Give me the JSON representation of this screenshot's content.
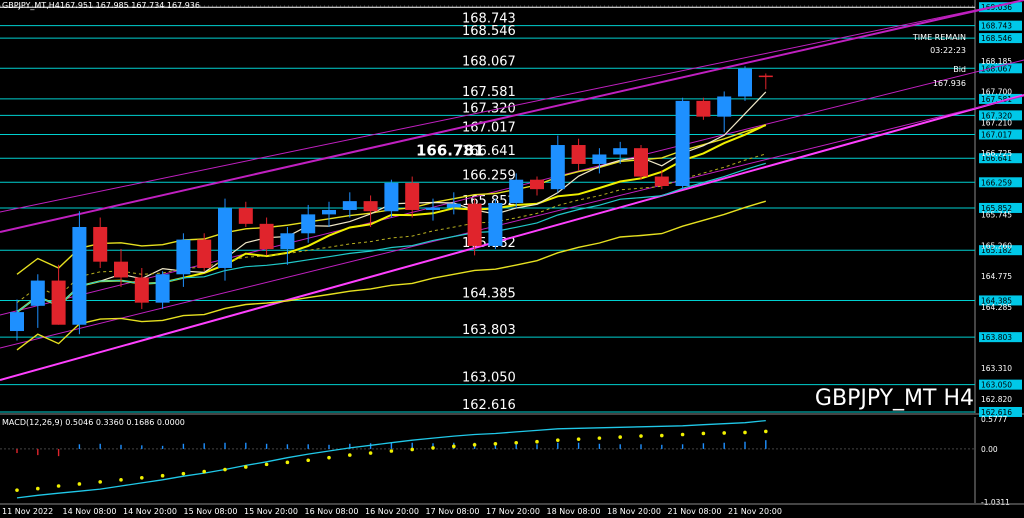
{
  "chart_data": {
    "type": "candlestick",
    "symbol": "GBPJPY_MT,H4",
    "header_quote": "167.951 167.985 167.734 167.936",
    "watermark": "GBPJPY_MT H4",
    "time_remain_label": "TIME REMAIN",
    "time_remain_value": "03:22:23",
    "bid_label": "Bid",
    "bid_value": "167.936",
    "pivot_label": "166.781",
    "ylim": [
      162.6,
      169.15
    ],
    "price_axis_ticks": [
      "168.185",
      "167.700",
      "167.210",
      "166.725",
      "165.745",
      "165.260",
      "164.775",
      "164.285",
      "163.310",
      "162.820"
    ],
    "levels": [
      {
        "label": "169.036",
        "value": 169.036,
        "line_color": "#ffffff",
        "show_left": false
      },
      {
        "label": "168.743",
        "value": 168.743,
        "line_color": "#00d0d0",
        "show_left": true
      },
      {
        "label": "168.546",
        "value": 168.546,
        "line_color": "#00d0d0",
        "show_left": true
      },
      {
        "label": "168.067",
        "value": 168.067,
        "line_color": "#00d0d0",
        "show_left": true
      },
      {
        "label": "167.581",
        "value": 167.581,
        "line_color": "#00d0d0",
        "show_left": true
      },
      {
        "label": "167.320",
        "value": 167.32,
        "line_color": "#00d0d0",
        "show_left": true
      },
      {
        "label": "167.017",
        "value": 167.017,
        "line_color": "#00d0d0",
        "show_left": true
      },
      {
        "label": "166.641",
        "value": 166.641,
        "line_color": "#00d0d0",
        "show_left": true
      },
      {
        "label": "166.259",
        "value": 166.259,
        "line_color": "#00d0d0",
        "show_left": true
      },
      {
        "label": "165.852",
        "value": 165.852,
        "line_color": "#00d0d0",
        "show_left": true
      },
      {
        "label": "165.182",
        "value": 165.182,
        "line_color": "#00d0d0",
        "show_left": true
      },
      {
        "label": "164.385",
        "value": 164.385,
        "line_color": "#00d0d0",
        "show_left": true
      },
      {
        "label": "163.803",
        "value": 163.803,
        "line_color": "#00d0d0",
        "show_left": true
      },
      {
        "label": "163.050",
        "value": 163.05,
        "line_color": "#00d0d0",
        "show_left": true
      },
      {
        "label": "162.616",
        "value": 162.616,
        "line_color": "#00d0d0",
        "show_left": true
      }
    ],
    "x_labels": [
      "11 Nov 2022",
      "14 Nov 08:00",
      "14 Nov 20:00",
      "15 Nov 08:00",
      "15 Nov 20:00",
      "16 Nov 08:00",
      "16 Nov 20:00",
      "17 Nov 08:00",
      "17 Nov 20:00",
      "18 Nov 08:00",
      "18 Nov 20:00",
      "21 Nov 08:00",
      "21 Nov 20:00"
    ],
    "candles": [
      {
        "o": 163.9,
        "h": 164.4,
        "l": 163.75,
        "c": 164.2
      },
      {
        "o": 164.3,
        "h": 164.8,
        "l": 163.95,
        "c": 164.7
      },
      {
        "o": 164.7,
        "h": 164.95,
        "l": 164.0,
        "c": 164.0
      },
      {
        "o": 164.0,
        "h": 165.8,
        "l": 163.85,
        "c": 165.55
      },
      {
        "o": 165.55,
        "h": 165.7,
        "l": 164.9,
        "c": 165.0
      },
      {
        "o": 165.0,
        "h": 165.2,
        "l": 164.6,
        "c": 164.75
      },
      {
        "o": 164.75,
        "h": 164.9,
        "l": 164.25,
        "c": 164.35
      },
      {
        "o": 164.35,
        "h": 164.85,
        "l": 164.25,
        "c": 164.8
      },
      {
        "o": 164.8,
        "h": 165.45,
        "l": 164.6,
        "c": 165.35
      },
      {
        "o": 165.35,
        "h": 165.45,
        "l": 164.85,
        "c": 164.9
      },
      {
        "o": 164.9,
        "h": 166.0,
        "l": 164.7,
        "c": 165.85
      },
      {
        "o": 165.85,
        "h": 165.95,
        "l": 165.55,
        "c": 165.6
      },
      {
        "o": 165.6,
        "h": 165.7,
        "l": 165.1,
        "c": 165.2
      },
      {
        "o": 165.2,
        "h": 165.55,
        "l": 164.95,
        "c": 165.45
      },
      {
        "o": 165.45,
        "h": 165.9,
        "l": 165.3,
        "c": 165.75
      },
      {
        "o": 165.75,
        "h": 165.95,
        "l": 165.55,
        "c": 165.82
      },
      {
        "o": 165.82,
        "h": 166.1,
        "l": 165.7,
        "c": 165.96
      },
      {
        "o": 165.96,
        "h": 166.05,
        "l": 165.55,
        "c": 165.8
      },
      {
        "o": 165.8,
        "h": 166.3,
        "l": 165.7,
        "c": 166.25
      },
      {
        "o": 166.25,
        "h": 166.35,
        "l": 165.7,
        "c": 165.82
      },
      {
        "o": 165.82,
        "h": 166.0,
        "l": 165.65,
        "c": 165.86
      },
      {
        "o": 165.86,
        "h": 166.1,
        "l": 165.75,
        "c": 165.92
      },
      {
        "o": 165.92,
        "h": 166.0,
        "l": 165.1,
        "c": 165.25
      },
      {
        "o": 165.25,
        "h": 166.0,
        "l": 165.2,
        "c": 165.93
      },
      {
        "o": 165.93,
        "h": 166.4,
        "l": 165.85,
        "c": 166.3
      },
      {
        "o": 166.3,
        "h": 166.35,
        "l": 166.05,
        "c": 166.15
      },
      {
        "o": 166.15,
        "h": 167.0,
        "l": 166.1,
        "c": 166.85
      },
      {
        "o": 166.85,
        "h": 166.95,
        "l": 166.45,
        "c": 166.55
      },
      {
        "o": 166.55,
        "h": 166.8,
        "l": 166.4,
        "c": 166.7
      },
      {
        "o": 166.7,
        "h": 166.9,
        "l": 166.55,
        "c": 166.8
      },
      {
        "o": 166.8,
        "h": 166.85,
        "l": 166.3,
        "c": 166.35
      },
      {
        "o": 166.35,
        "h": 166.45,
        "l": 166.15,
        "c": 166.2
      },
      {
        "o": 166.2,
        "h": 167.6,
        "l": 166.15,
        "c": 167.55
      },
      {
        "o": 167.55,
        "h": 167.6,
        "l": 167.25,
        "c": 167.3
      },
      {
        "o": 167.3,
        "h": 167.7,
        "l": 167.05,
        "c": 167.62
      },
      {
        "o": 167.62,
        "h": 168.1,
        "l": 167.55,
        "c": 168.06
      },
      {
        "o": 167.951,
        "h": 167.985,
        "l": 167.734,
        "c": 167.936
      }
    ],
    "macd": {
      "label": "MACD(12,26,9) 0.5046 0.3360 0.1686 0.0000",
      "ylim": [
        -1.05,
        0.62
      ],
      "axis_ticks": [
        "0.5777",
        "0.00",
        "-1.0311"
      ],
      "signal": [
        -0.8,
        -0.77,
        -0.72,
        -0.68,
        -0.64,
        -0.6,
        -0.56,
        -0.52,
        -0.48,
        -0.44,
        -0.4,
        -0.35,
        -0.3,
        -0.26,
        -0.22,
        -0.17,
        -0.12,
        -0.08,
        -0.04,
        -0.01,
        0.02,
        0.05,
        0.08,
        0.1,
        0.12,
        0.14,
        0.17,
        0.19,
        0.21,
        0.23,
        0.25,
        0.26,
        0.28,
        0.3,
        0.31,
        0.32,
        0.34
      ],
      "macd_line": [
        -0.95,
        -0.9,
        -0.86,
        -0.82,
        -0.78,
        -0.72,
        -0.66,
        -0.6,
        -0.53,
        -0.47,
        -0.4,
        -0.32,
        -0.25,
        -0.17,
        -0.1,
        -0.04,
        0.02,
        0.07,
        0.12,
        0.17,
        0.21,
        0.25,
        0.28,
        0.3,
        0.33,
        0.36,
        0.39,
        0.4,
        0.41,
        0.42,
        0.43,
        0.44,
        0.45,
        0.47,
        0.49,
        0.51,
        0.55
      ],
      "histogram": [
        -0.08,
        -0.12,
        -0.14,
        0.09,
        0.1,
        0.08,
        0.07,
        0.06,
        0.1,
        0.11,
        0.12,
        0.12,
        0.1,
        0.09,
        0.09,
        0.08,
        0.1,
        0.11,
        0.12,
        0.12,
        0.11,
        0.12,
        0.12,
        0.1,
        0.1,
        0.09,
        0.12,
        0.12,
        0.1,
        0.09,
        0.09,
        0.08,
        0.09,
        0.11,
        0.12,
        0.14,
        0.17
      ]
    }
  }
}
